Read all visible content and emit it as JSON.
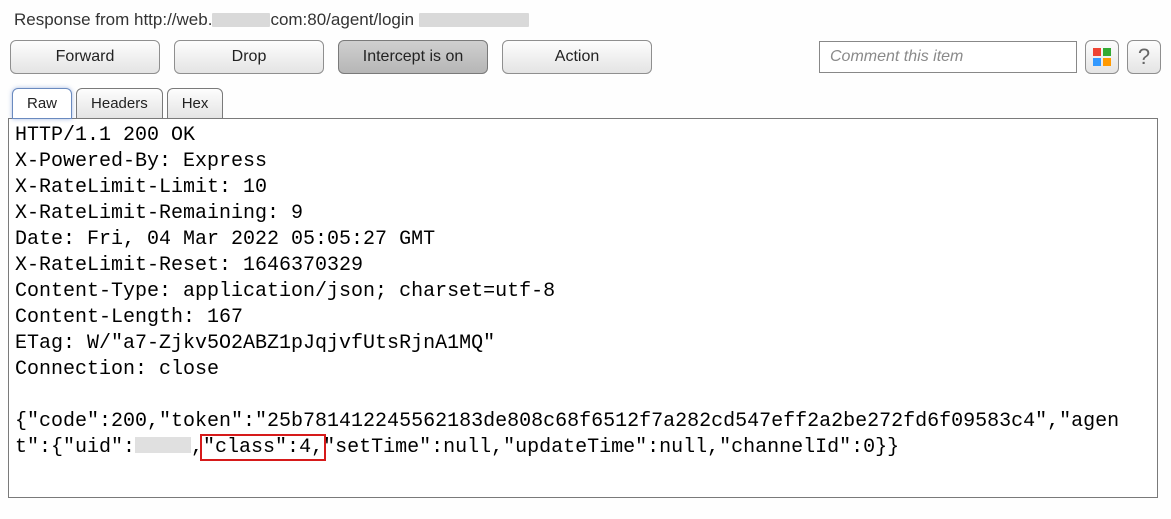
{
  "title": {
    "prefix": "Response from http://web.",
    "mid": "com:80/agent/login"
  },
  "toolbar": {
    "forward": "Forward",
    "drop": "Drop",
    "intercept": "Intercept is on",
    "action": "Action",
    "comment_placeholder": "Comment this item"
  },
  "tabs": {
    "raw": "Raw",
    "headers": "Headers",
    "hex": "Hex"
  },
  "response": {
    "status_line": "HTTP/1.1 200 OK",
    "headers": [
      "X-Powered-By: Express",
      "X-RateLimit-Limit: 10",
      "X-RateLimit-Remaining: 9",
      "Date: Fri, 04 Mar 2022 05:05:27 GMT",
      "X-RateLimit-Reset: 1646370329",
      "Content-Type: application/json; charset=utf-8",
      "Content-Length: 167",
      "ETag: W/\"a7-Zjkv5O2ABZ1pJqjvfUtsRjnA1MQ\"",
      "Connection: close"
    ],
    "body_pre": "{\"code\":200,\"token\":\"25b781412245562183de808c68f6512f7a282cd547eff2a2be272fd6f09583c4\",\"agent\":{\"uid\":",
    "body_highlight": "\"class\":4,",
    "body_post": "\"setTime\":null,\"updateTime\":null,\"channelId\":0}}"
  }
}
